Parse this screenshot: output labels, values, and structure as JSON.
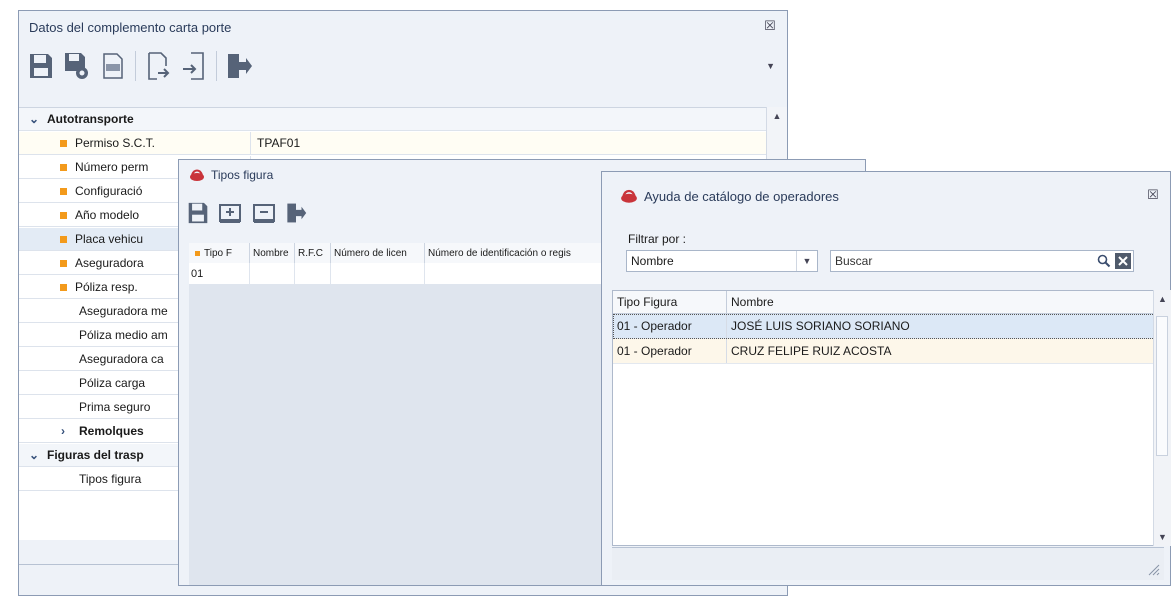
{
  "main_window": {
    "title": "Datos del complemento carta porte",
    "close_glyph": "☒",
    "toolbar": [
      "save-icon",
      "save-as-icon",
      "pdf-icon",
      "export-icon",
      "import-icon",
      "exit-icon"
    ],
    "categories": {
      "autotransporte": "Autotransporte",
      "remolques": "Remolques",
      "figuras": "Figuras del trasp"
    },
    "rows": [
      {
        "label": "Permiso S.C.T.",
        "value": "TPAF01",
        "required": true
      },
      {
        "label": "Número perm",
        "value": "",
        "required": true
      },
      {
        "label": "Configuració",
        "value": "",
        "required": true
      },
      {
        "label": "Año modelo",
        "value": "",
        "required": true
      },
      {
        "label": "Placa vehicu",
        "value": "",
        "required": true
      },
      {
        "label": "Aseguradora",
        "value": "",
        "required": true
      },
      {
        "label": "Póliza resp.",
        "value": "",
        "required": true
      },
      {
        "label": "Aseguradora me",
        "value": "",
        "required": false
      },
      {
        "label": "Póliza medio am",
        "value": "",
        "required": false
      },
      {
        "label": "Aseguradora ca",
        "value": "",
        "required": false
      },
      {
        "label": "Póliza carga",
        "value": "",
        "required": false
      },
      {
        "label": "Prima seguro",
        "value": "",
        "required": false
      }
    ],
    "figuras_row": "Tipos figura"
  },
  "tipos_window": {
    "title": "Tipos figura",
    "columns": [
      "Tipo F",
      "Nombre",
      "R.F.C",
      "Número de licen",
      "Número de identificación o regis"
    ],
    "rows": [
      [
        "01",
        "",
        "",
        "",
        ""
      ]
    ]
  },
  "ayuda_window": {
    "title": "Ayuda de catálogo de  operadores",
    "close_glyph": "☒",
    "filter_label": "Filtrar por :",
    "filter_value": "Nombre",
    "search_value": "Buscar",
    "columns": [
      "Tipo Figura",
      "Nombre"
    ],
    "rows": [
      [
        "01 - Operador",
        "JOSÉ LUIS SORIANO SORIANO"
      ],
      [
        "01 - Operador",
        "CRUZ FELIPE RUIZ ACOSTA"
      ]
    ]
  }
}
